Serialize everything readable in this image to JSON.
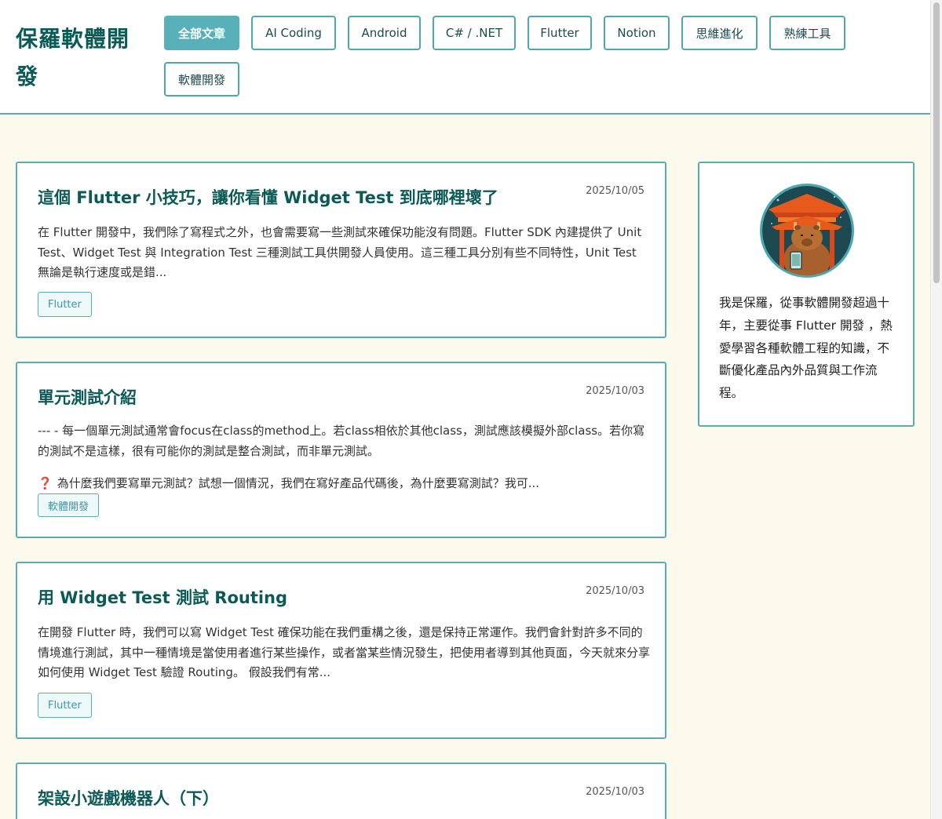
{
  "site": {
    "title": "保羅軟體開發"
  },
  "nav": {
    "items": [
      {
        "label": "全部文章",
        "active": true
      },
      {
        "label": "AI Coding"
      },
      {
        "label": "Android"
      },
      {
        "label": "C# / .NET"
      },
      {
        "label": "Flutter"
      },
      {
        "label": "Notion"
      },
      {
        "label": "思維進化"
      },
      {
        "label": "熟練工具"
      },
      {
        "label": "軟體開發"
      }
    ]
  },
  "posts": [
    {
      "title": "這個 Flutter 小技巧，讓你看懂 Widget Test 到底哪裡壞了",
      "date": "2025/10/05",
      "excerpt": "在 Flutter 開發中，我們除了寫程式之外，也會需要寫一些測試來確保功能沒有問題。Flutter SDK 內建提供了 Unit Test、Widget Test 與 Integration Test 三種測試工具供開發人員使用。這三種工具分別有些不同特性，Unit Test 無論是執行速度或是錯...",
      "tag": "Flutter"
    },
    {
      "title": "單元測試介紹",
      "date": "2025/10/03",
      "excerpt": "--- - 每一個單元測試通常會focus在class的method上。若class相依於其他class，測試應該模擬外部class。若你寫的測試不是這樣，很有可能你的測試是整合測試，而非單元測試。",
      "excerpt2_icon": "❓",
      "excerpt2": "為什麼我們要寫單元測試？試想一個情況，我們在寫好產品代碼後，為什麼要寫測試？我可...",
      "tag": "軟體開發"
    },
    {
      "title": "用 Widget Test 測試 Routing",
      "date": "2025/10/03",
      "excerpt": "在開發 Flutter 時，我們可以寫 Widget Test 確保功能在我們重構之後，還是保持正常運作。我們會針對許多不同的情境進行測試，其中一種情境是當使用者進行某些操作，或者當某些情況發生，把使用者導到其他頁面，今天就來分享如何使用 Widget Test 驗證 Routing。 假設我們有常...",
      "tag": "Flutter"
    },
    {
      "title": "架設小遊戲機器人（下）",
      "date": "2025/10/03"
    }
  ],
  "profile": {
    "avatar_icon": "capybara-temple-avatar",
    "bio": "我是保羅，從事軟體開發超過十年，主要從事 Flutter 開發 ，熱愛學習各種軟體工程的知識，不斷優化產品內外品質與工作流程。"
  },
  "colors": {
    "accent": "#58adb5",
    "title": "#0b5a56",
    "background": "#fcfaec",
    "tag_background": "#eef8f8",
    "question_icon": "#d6262b"
  }
}
